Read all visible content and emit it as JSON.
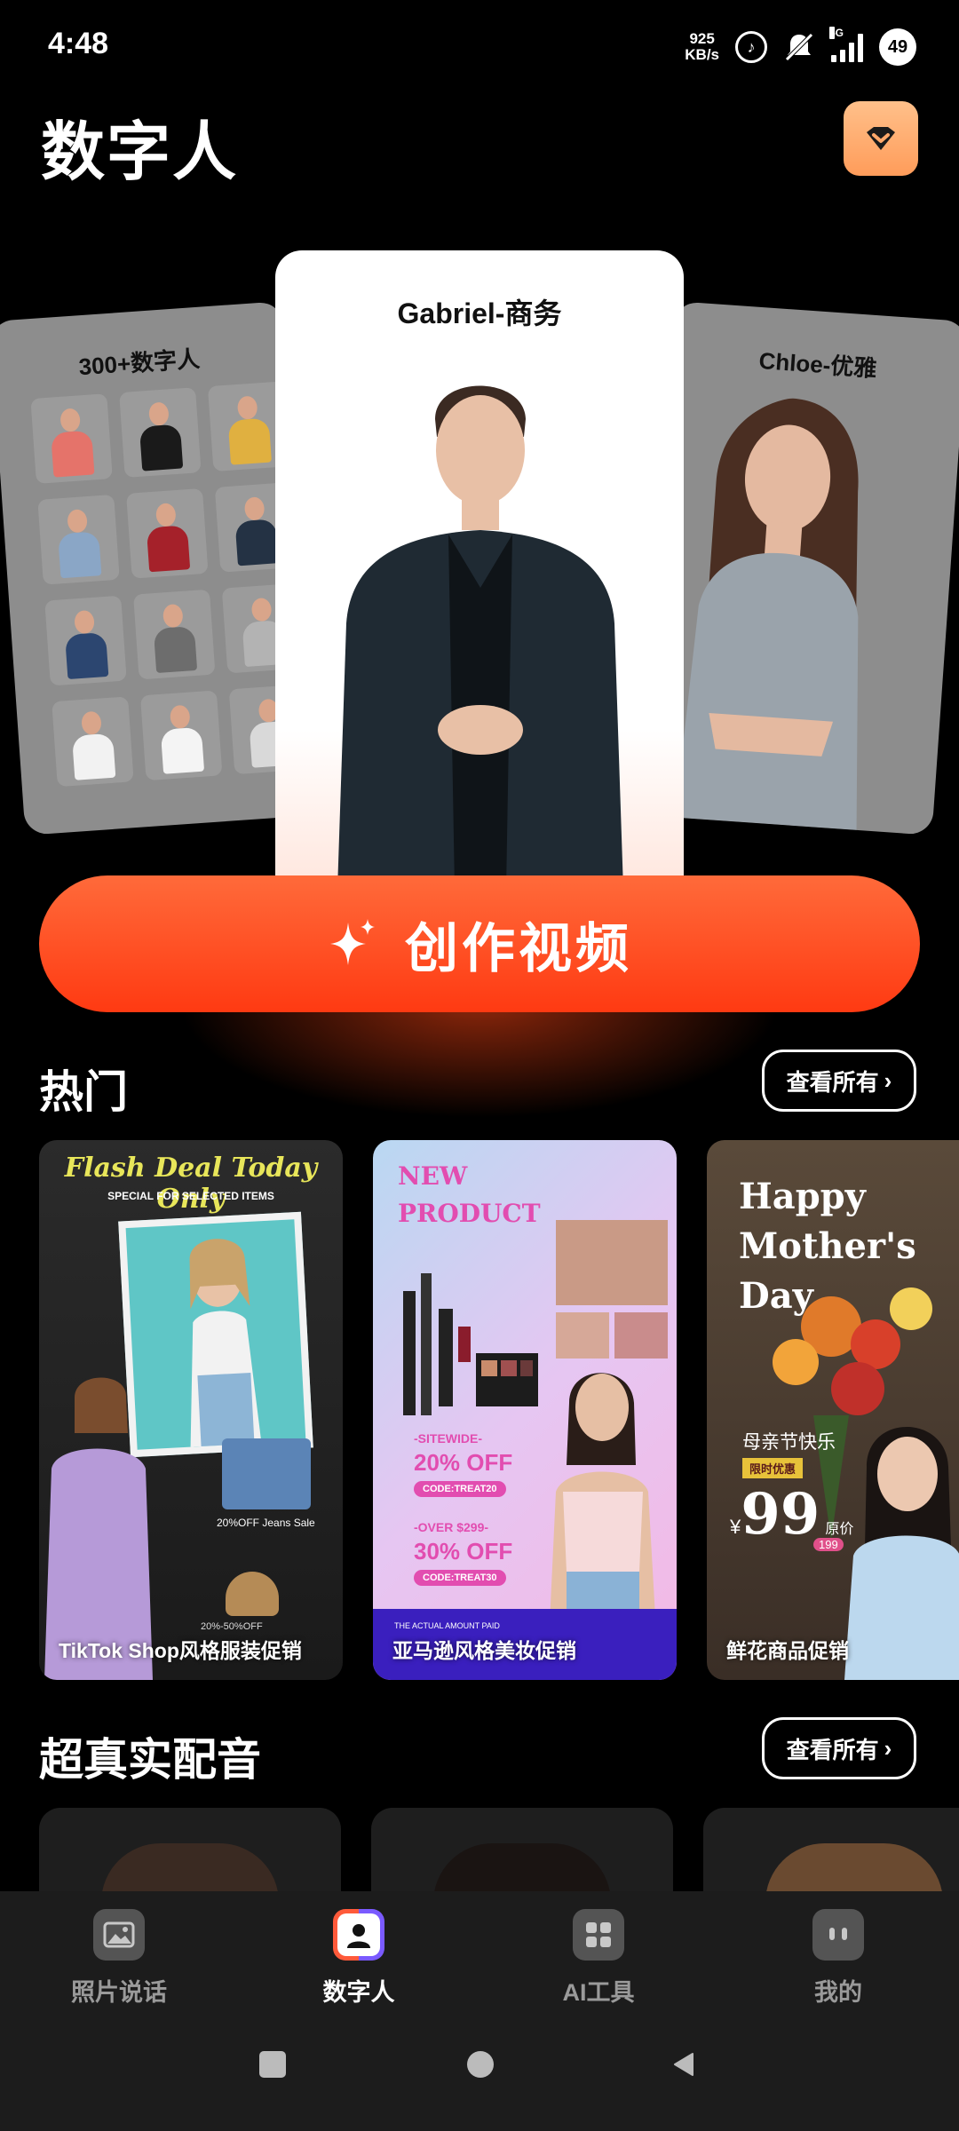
{
  "status_bar": {
    "time": "4:48",
    "net_speed_value": "925",
    "net_speed_unit": "KB/s",
    "network_type": "5G",
    "battery": "49"
  },
  "header": {
    "title": "数字人",
    "vip_icon": "diamond-icon"
  },
  "carousel": {
    "left_card_title": "300+数字人",
    "center_card_title": "Gabriel-商务",
    "right_card_title": "Chloe-优雅"
  },
  "create_button": {
    "label": "创作视频",
    "icon": "sparkle-icon"
  },
  "hot_section": {
    "title": "热门",
    "see_all": "查看所有",
    "templates": [
      {
        "caption": "TikTok Shop风格服装促销",
        "headline": "Flash Deal Today Only",
        "subline": "SPECIAL FOR SELECTED ITEMS",
        "discount_text": "20%OFF  Jeans Sale",
        "discount_text2": "20%-50%OFF"
      },
      {
        "caption": "亚马逊风格美妆促销",
        "headline_1": "NEW",
        "headline_2": "PRODUCT",
        "offer1_label": "-SITEWIDE-",
        "offer1_value": "20% OFF",
        "offer1_code": "CODE:TREAT20",
        "offer2_label": "-OVER $299-",
        "offer2_value": "30% OFF",
        "offer2_code": "CODE:TREAT30",
        "footer_note": "THE ACTUAL AMOUNT PAID"
      },
      {
        "caption": "鲜花商品促销",
        "headline_1": "Happy",
        "headline_2": "Mother's",
        "headline_3": "Day",
        "subtitle": "母亲节快乐",
        "badge": "限时优惠",
        "price_symbol": "¥",
        "price": "99",
        "price_label": "原价",
        "original_price": "199"
      }
    ]
  },
  "voice_section": {
    "title": "超真实配音",
    "see_all": "查看所有"
  },
  "bottom_nav": {
    "items": [
      {
        "label": "照片说话",
        "icon": "photo-icon"
      },
      {
        "label": "数字人",
        "icon": "avatar-icon"
      },
      {
        "label": "AI工具",
        "icon": "apps-grid-icon"
      },
      {
        "label": "我的",
        "icon": "profile-icon"
      }
    ]
  },
  "colors": {
    "accent": "#ff4a1e",
    "vip": "#ffa86a",
    "background": "#000000",
    "nav_background": "#1c1c1c"
  }
}
